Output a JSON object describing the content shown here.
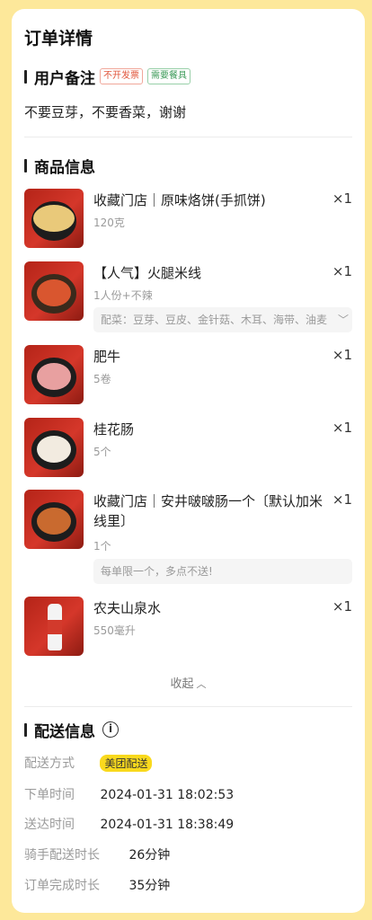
{
  "title": "订单详情",
  "remark_section": {
    "title": "用户备注",
    "tags": [
      "不开发票",
      "需要餐具"
    ],
    "text": "不要豆芽，不要香菜，谢谢"
  },
  "goods_section": {
    "title": "商品信息",
    "items": [
      {
        "name": "收藏门店｜原味烙饼(手抓饼)",
        "qty": "×1",
        "spec": "120克"
      },
      {
        "name": "【人气】火腿米线",
        "qty": "×1",
        "spec": "1人份+不辣",
        "note": "配菜：豆芽、豆皮、金针菇、木耳、海带、油麦"
      },
      {
        "name": "肥牛",
        "qty": "×1",
        "spec": "5卷"
      },
      {
        "name": "桂花肠",
        "qty": "×1",
        "spec": "5个"
      },
      {
        "name": "收藏门店｜安井啵啵肠一个〔默认加米线里〕",
        "qty": "×1",
        "spec": "1个",
        "note": "每单限一个，多点不送!"
      },
      {
        "name": "农夫山泉水",
        "qty": "×1",
        "spec": "550毫升"
      }
    ],
    "collapse_label": "收起"
  },
  "delivery_section": {
    "title": "配送信息",
    "rows": [
      {
        "label": "配送方式",
        "value": "美团配送"
      },
      {
        "label": "下单时间",
        "value": "2024-01-31 18:02:53"
      },
      {
        "label": "送达时间",
        "value": "2024-01-31 18:38:49"
      },
      {
        "label": "骑手配送时长",
        "value": "26分钟"
      },
      {
        "label": "订单完成时长",
        "value": "35分钟"
      }
    ]
  },
  "colors": {
    "background": "#fde89a",
    "badge": "#f9d91d",
    "tag_red": "#e0553b",
    "tag_green": "#3e9b5a"
  },
  "icons": {
    "info": "info-circle-icon",
    "collapse": "chevron-up-icon",
    "expand_note": "chevron-down-icon"
  }
}
